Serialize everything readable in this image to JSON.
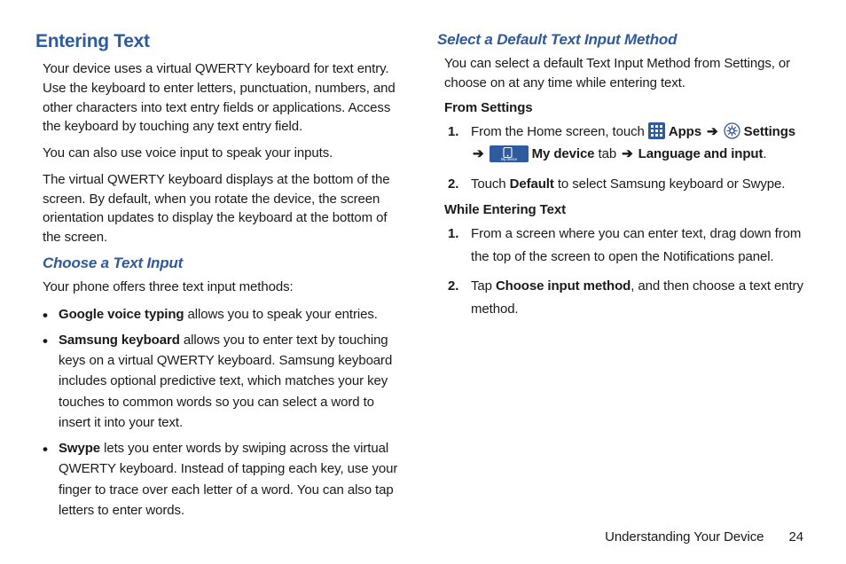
{
  "left": {
    "h1": "Entering Text",
    "p1": "Your device uses a virtual QWERTY keyboard for text entry. Use the keyboard to enter letters, punctuation, numbers, and other characters into text entry fields or applications. Access the keyboard by touching any text entry field.",
    "p2": "You can also use voice input to speak your inputs.",
    "p3": "The virtual QWERTY keyboard displays at the bottom of the screen. By default, when you rotate the device, the screen orientation updates to display the keyboard at the bottom of the screen.",
    "h2": "Choose a Text Input",
    "p4": "Your phone offers three text input methods:",
    "bullets": [
      {
        "lead": "Google voice typing",
        "rest": " allows you to speak your entries."
      },
      {
        "lead": "Samsung keyboard",
        "rest": " allows you to enter text by touching keys on a virtual QWERTY keyboard. Samsung keyboard includes optional predictive text, which matches your key touches to common words so you can select a word to insert it into your text."
      },
      {
        "lead": "Swype",
        "rest": " lets you enter words by swiping across the virtual QWERTY keyboard. Instead of tapping each key, use your finger to trace over each letter of a word. You can also tap letters to enter words."
      }
    ]
  },
  "right": {
    "h2": "Select a Default Text Input Method",
    "p1": "You can select a default Text Input Method from Settings, or choose on at any time while entering text.",
    "h3a": "From Settings",
    "steps_a": {
      "s1_pre": "From the Home screen, touch ",
      "apps": "Apps",
      "arrow": "➔",
      "settings": "Settings",
      "mydevice": "My device",
      "tab": " tab ",
      "lang": "Language and input",
      "s2_pre": "Touch ",
      "default": "Default",
      "s2_post": " to select Samsung keyboard or Swype."
    },
    "h3b": "While Entering Text",
    "steps_b": {
      "s1": "From a screen where you can enter text, drag down from the top of the screen to open the Notifications panel.",
      "s2_pre": "Tap ",
      "choose": "Choose input method",
      "s2_post": ", and then choose a text entry method."
    }
  },
  "footer": {
    "section": "Understanding Your Device",
    "page": "24"
  }
}
